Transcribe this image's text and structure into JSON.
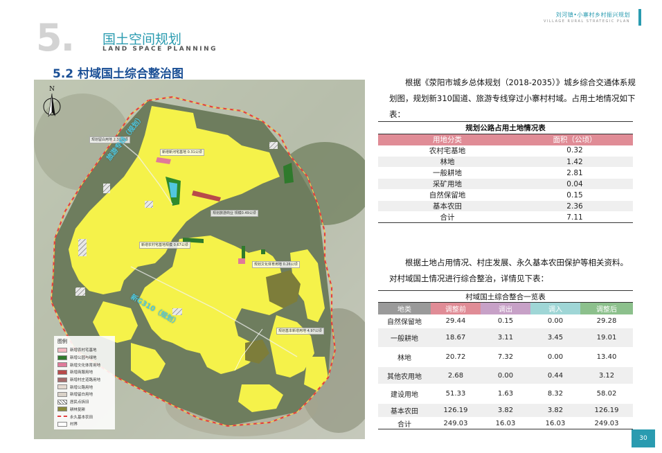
{
  "header": {
    "title": "刘河镇•小寨村乡村振兴规划",
    "subtitle": "VILLAGE RURAL STRATEGIC PLAN"
  },
  "chapter": {
    "number": "5.",
    "title_cn": "国土空间规划",
    "title_en": "LAND SPACE PLANNING"
  },
  "section_title": "5.2 村域国土综合整治图",
  "map": {
    "north": "N",
    "road_labels": [
      "旅游专线（规划）",
      "新G310（规划）"
    ],
    "labels": [
      "规划留白用地 2.31公顷",
      "新增新河宅基地 0.31公顷",
      "规划旅游商业 规模0.49公顷",
      "新增农村宅基地规模 0.67公顷",
      "规划文化体育用地 0.26公顷",
      "规划基本新增用地 4.97公顷"
    ],
    "legend": {
      "title": "图例",
      "items": [
        {
          "label": "新增农村宅基地",
          "color": "#f2b8c0"
        },
        {
          "label": "新增公园与绿地",
          "color": "#2f7a2c"
        },
        {
          "label": "新增文化体育用地",
          "color": "#e07a9a"
        },
        {
          "label": "新增商服用地",
          "color": "#b84a4a"
        },
        {
          "label": "新增村庄道路用地",
          "color": "#a56b6b"
        },
        {
          "label": "新增公路用地",
          "color": "#e4d9d0"
        },
        {
          "label": "新增留白用地",
          "color": "#d9d2c8"
        },
        {
          "label": "居民点拆旧",
          "color": "#ffffff"
        },
        {
          "label": "耕林复耕",
          "color": "#8a8a3a"
        },
        {
          "label": "永久基本农田",
          "color": "#ffff66"
        },
        {
          "label": "村界",
          "color": "#ffffff"
        }
      ]
    }
  },
  "paragraph1": "根据《荥阳市城乡总体规划（2018-2035）》城乡综合交通体系规划图，规划新310国道、旅游专线穿过小寨村村域。占用土地情况如下表：",
  "table1": {
    "caption": "规划公路占用土地情况表",
    "headers": [
      "用地分类",
      "面积（公顷）"
    ],
    "rows": [
      [
        "农村宅基地",
        "0.32"
      ],
      [
        "林地",
        "1.42"
      ],
      [
        "一般耕地",
        "2.81"
      ],
      [
        "采矿用地",
        "0.04"
      ],
      [
        "自然保留地",
        "0.15"
      ],
      [
        "基本农田",
        "2.36"
      ],
      [
        "合计",
        "7.11"
      ]
    ]
  },
  "paragraph2": "根据土地占用情况、村庄发展、永久基本农田保护等相关资料。对村域国土情况进行综合整治，详情见下表：",
  "table2": {
    "caption": "村域国土综合整合一览表",
    "headers": [
      "地类",
      "调整前",
      "调出",
      "调入",
      "调整后"
    ],
    "header_colors": [
      "#9a9a9a",
      "#e08c96",
      "#c7a1c7",
      "#9fd6d6",
      "#8cc08c"
    ],
    "rows": [
      [
        "自然保留地",
        "29.44",
        "0.15",
        "0.00",
        "29.28"
      ],
      [
        "一般耕地",
        "18.67",
        "3.11",
        "3.45",
        "19.01"
      ],
      [
        "林地",
        "20.72",
        "7.32",
        "0.00",
        "13.40"
      ],
      [
        "其他农用地",
        "2.68",
        "0.00",
        "0.44",
        "3.12"
      ],
      [
        "建设用地",
        "51.33",
        "1.63",
        "8.32",
        "58.02"
      ],
      [
        "基本农田",
        "126.19",
        "3.82",
        "3.82",
        "126.19"
      ],
      [
        "合计",
        "249.03",
        "16.03",
        "16.03",
        "249.03"
      ]
    ]
  },
  "page_number": "30"
}
